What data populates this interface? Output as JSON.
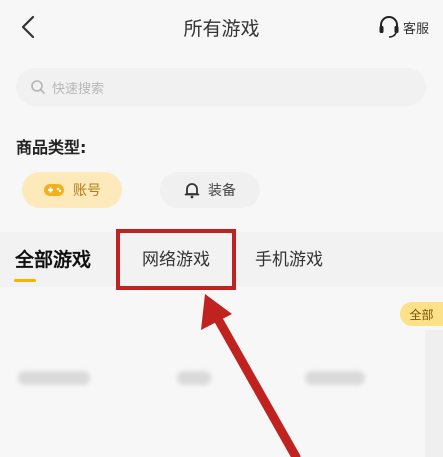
{
  "header": {
    "title": "所有游戏",
    "service_label": "客服"
  },
  "search": {
    "placeholder": "快速搜索"
  },
  "filter": {
    "label": "商品类型:",
    "chips": [
      {
        "label": "账号",
        "active": true,
        "icon": "gamepad-icon"
      },
      {
        "label": "装备",
        "active": false,
        "icon": "bell-icon"
      }
    ]
  },
  "tabs": [
    {
      "label": "全部游戏",
      "active": true
    },
    {
      "label": "网络游戏",
      "active": false,
      "highlighted": true
    },
    {
      "label": "手机游戏",
      "active": false
    }
  ],
  "side_badge": "全部",
  "colors": {
    "accent": "#f5b400",
    "chip_active_bg": "#fde9b9",
    "highlight_box": "#c0231f"
  }
}
